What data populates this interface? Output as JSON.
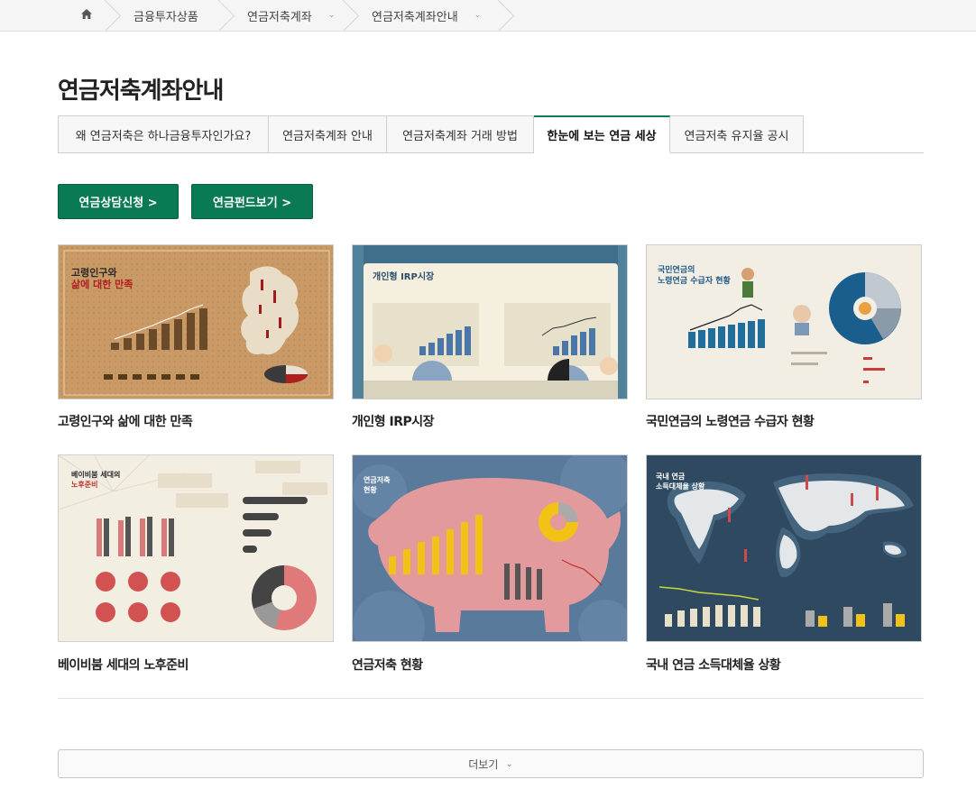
{
  "breadcrumb": {
    "home_icon": "home-icon",
    "items": [
      {
        "label": "금융투자상품",
        "has_caret": false
      },
      {
        "label": "연금저축계좌",
        "has_caret": true
      },
      {
        "label": "연금저축계좌안내",
        "has_caret": true
      }
    ]
  },
  "page_title": "연금저축계좌안내",
  "tabs": [
    {
      "label": "왜 연금저축은 하나금융투자인가요?",
      "active": false
    },
    {
      "label": "연금저축계좌 안내",
      "active": false
    },
    {
      "label": "연금저축계좌 거래 방법",
      "active": false
    },
    {
      "label": "한눈에 보는 연금 세상",
      "active": true
    },
    {
      "label": "연금저축 유지율 공시",
      "active": false
    }
  ],
  "buttons": {
    "consult": "연금상담신청 >",
    "funds": "연금펀드보기 >"
  },
  "cards": [
    {
      "caption": "고령인구와 삶에 대한 만족",
      "thumb_title": "고령인구와",
      "thumb_title2": "삶에 대한 만족"
    },
    {
      "caption": "개인형 IRP시장",
      "thumb_title": "개인형 IRP시장"
    },
    {
      "caption": "국민연금의 노령연금 수급자 현황",
      "thumb_title": "국민연금의",
      "thumb_title2": "노령연금 수급자 현황"
    },
    {
      "caption": "베이비붐 세대의 노후준비",
      "thumb_title": "베이비붐 세대의",
      "thumb_title2": "노후준비"
    },
    {
      "caption": "연금저축 현황",
      "thumb_title": "연금저축",
      "thumb_title2": "현황"
    },
    {
      "caption": "국내 연금 소득대체율 상황",
      "thumb_title": "국내 연금",
      "thumb_title2": "소득대체율 상황"
    }
  ],
  "more_button": "더보기",
  "colors": {
    "accent_green": "#0a7a55",
    "tab_active_border": "#0a7c5b"
  }
}
